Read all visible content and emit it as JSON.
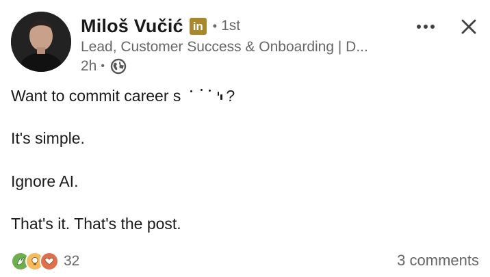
{
  "author": {
    "name": "Miloš Vučić",
    "badge": "in",
    "connection_sep": "•",
    "connection": "1st",
    "headline": "Lead, Customer Success & Onboarding | D...",
    "time": "2h",
    "time_sep": "•",
    "visibility_icon": "globe-icon"
  },
  "actions": {
    "more_icon": "more-horizontal-icon",
    "close_icon": "close-icon"
  },
  "post": {
    "line1_start": "Want to commit career s",
    "line1_end": "?",
    "line2": "It's simple.",
    "line3": "Ignore AI.",
    "line4": "That's it. That's the post."
  },
  "footer": {
    "reaction_icons": [
      "celebrate-icon",
      "insightful-icon",
      "love-icon"
    ],
    "reaction_count": "32",
    "comments": "3 comments"
  },
  "colors": {
    "text": "#191919",
    "muted": "#666666",
    "badge": "#a8882a",
    "celebrate": "#6dae4f",
    "insightful": "#f5bb5c",
    "love": "#df704d"
  }
}
